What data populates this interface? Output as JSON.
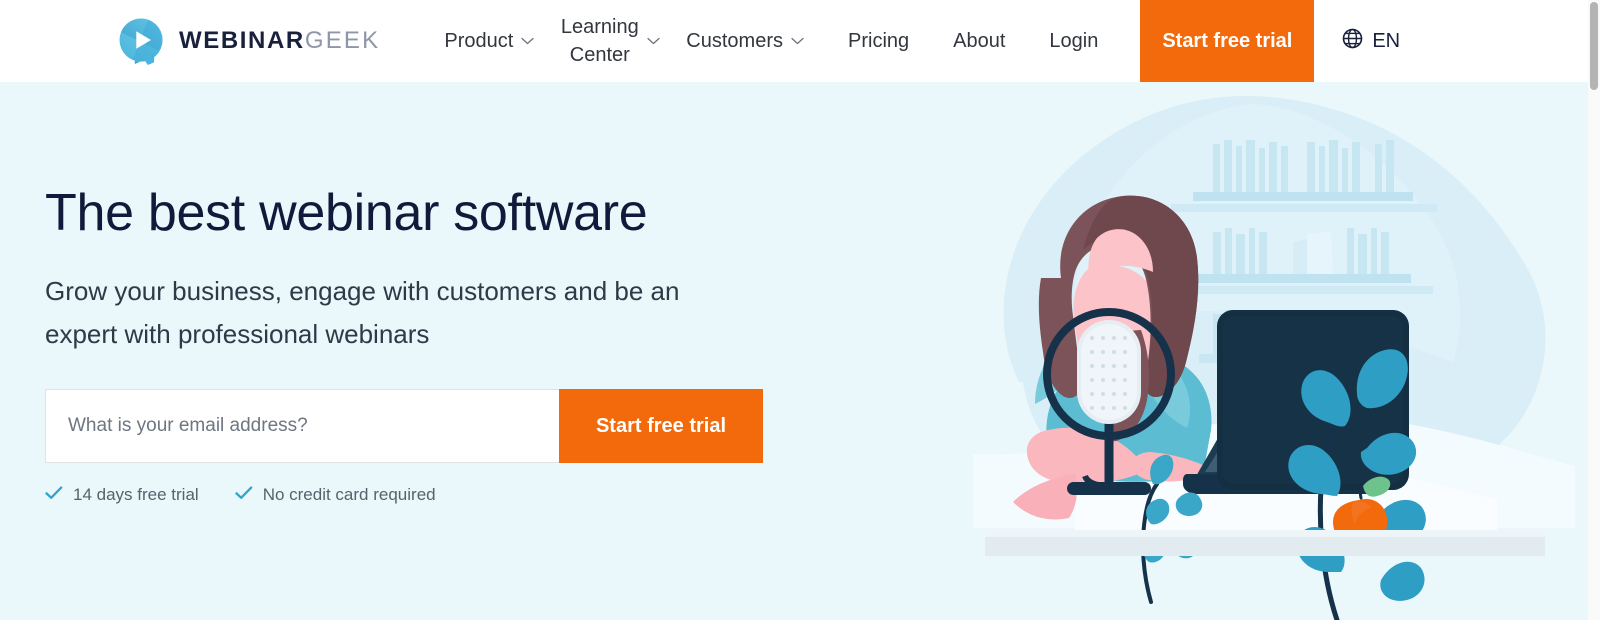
{
  "brand": {
    "logo_icon": "webinargeek-play-bubble-logo",
    "name_bold": "WEBINAR",
    "name_light": "GEEK",
    "accent_orange": "#f26a0c",
    "dark_navy": "#121a3c",
    "hero_bg": "#eaf7fb",
    "teal": "#2e9ec4"
  },
  "header": {
    "nav": [
      {
        "label": "Product",
        "has_chevron": true,
        "two_line": false
      },
      {
        "label": "Learning Center",
        "has_chevron": true,
        "two_line": true
      },
      {
        "label": "Customers",
        "has_chevron": true,
        "two_line": false
      },
      {
        "label": "Pricing",
        "has_chevron": false,
        "two_line": false
      },
      {
        "label": "About",
        "has_chevron": false,
        "two_line": false
      },
      {
        "label": "Login",
        "has_chevron": false,
        "two_line": false
      }
    ],
    "cta_label": "Start free trial",
    "language": {
      "icon": "globe-icon",
      "code": "EN"
    }
  },
  "hero": {
    "headline": "The best webinar software",
    "subheadline": "Grow your business, engage with customers and be an expert with professional webinars",
    "form": {
      "email_placeholder": "What is your email address?",
      "email_value": "",
      "submit_label": "Start free trial"
    },
    "perks": [
      {
        "icon": "check-icon",
        "label": "14 days free trial"
      },
      {
        "icon": "check-icon",
        "label": "No credit card required"
      }
    ],
    "illustration": {
      "name": "woman-podcasting-at-desk-illustration",
      "elements": [
        "blob-background",
        "bookshelf",
        "woman-with-brown-hair-teal-blouse",
        "studio-microphone-with-ring",
        "navy-laptop-with-orange-dot",
        "orange-webcam",
        "orange-apple-with-green-leaf",
        "two-teal-leafy-plants",
        "white-desk"
      ]
    }
  },
  "scrollbar": {
    "position": "right",
    "thumb_at": "top"
  }
}
